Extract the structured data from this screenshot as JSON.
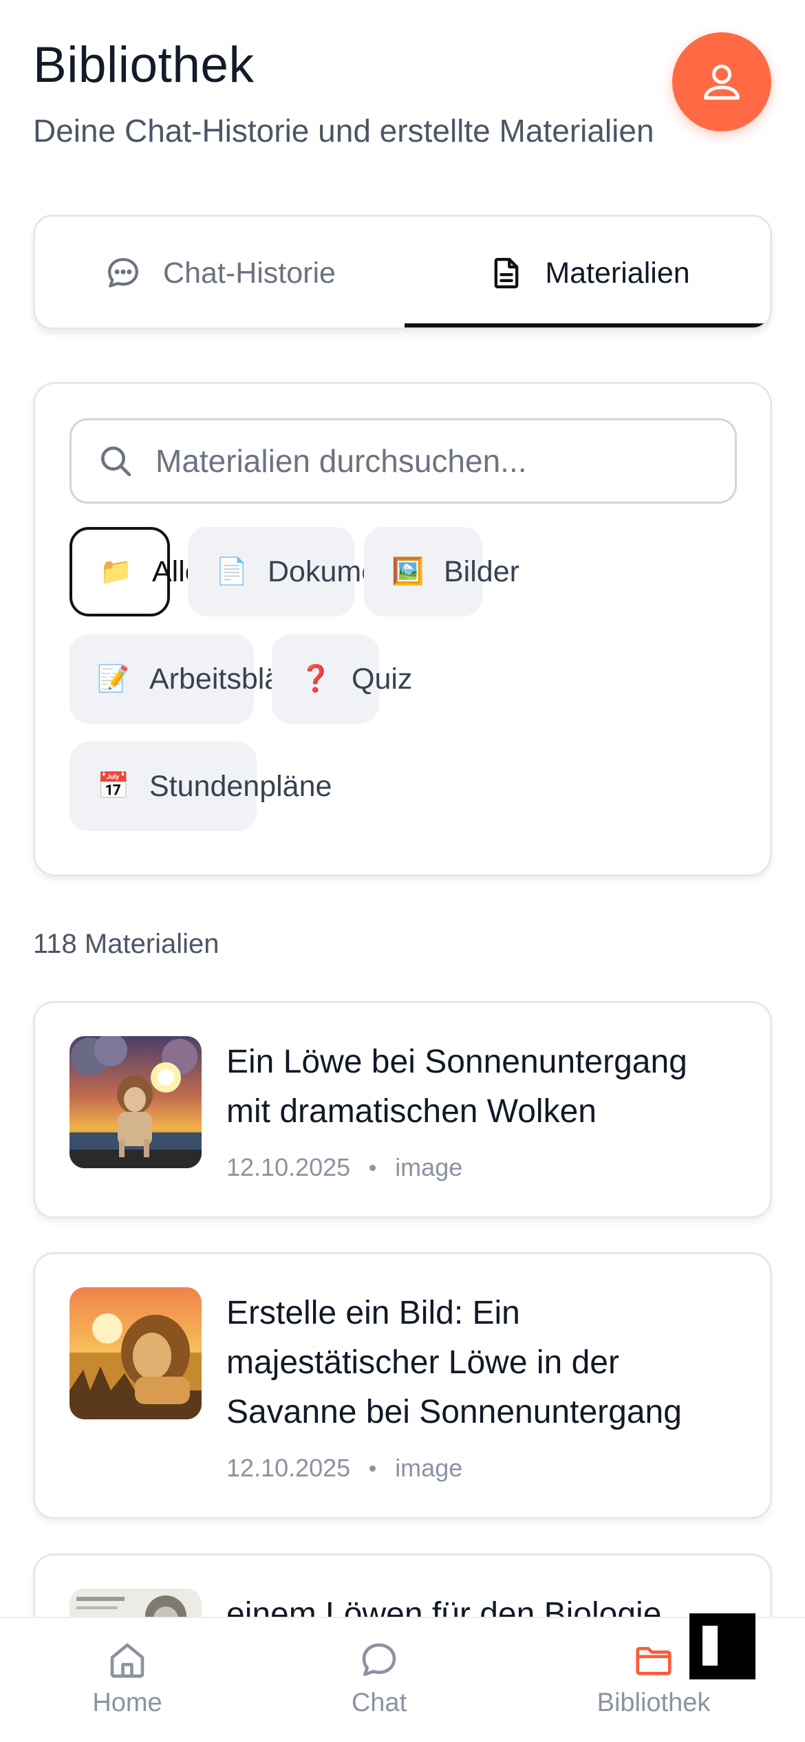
{
  "header": {
    "title": "Bibliothek",
    "subtitle": "Deine Chat-Historie und erstellte Materialien"
  },
  "profile": {
    "icon": "user-icon",
    "color": "#ff6a45"
  },
  "tabs": [
    {
      "label": "Chat-Historie",
      "icon": "chat-bubble-icon",
      "active": false
    },
    {
      "label": "Materialien",
      "icon": "document-icon",
      "active": true
    }
  ],
  "search": {
    "placeholder": "Materialien durchsuchen..."
  },
  "filters": [
    {
      "label": "Alle",
      "emoji": "📁",
      "active": true
    },
    {
      "label": "Dokumente",
      "emoji": "📄",
      "active": false
    },
    {
      "label": "Bilder",
      "emoji": "🖼️",
      "active": false
    },
    {
      "label": "Arbeitsblätter",
      "emoji": "📝",
      "active": false
    },
    {
      "label": "Quiz",
      "emoji": "❓",
      "active": false
    },
    {
      "label": "Stundenpläne",
      "emoji": "📅",
      "active": false
    }
  ],
  "count_label": "118 Materialien",
  "materials": [
    {
      "title": "Ein Löwe bei Sonnenuntergang mit dramatischen Wolken",
      "date": "12.10.2025",
      "type": "image"
    },
    {
      "title": "Erstelle ein Bild: Ein majestätischer Löwe in der Savanne bei Sonnenuntergang",
      "date": "12.10.2025",
      "type": "image"
    },
    {
      "title": "einem Löwen für den Biologie",
      "date": "",
      "type": ""
    }
  ],
  "nav": [
    {
      "label": "Home",
      "icon": "home-icon",
      "active": false
    },
    {
      "label": "Chat",
      "icon": "chat-icon",
      "active": false
    },
    {
      "label": "Bibliothek",
      "icon": "folder-icon",
      "active": true
    }
  ],
  "colors": {
    "accent": "#ff5a36",
    "text": "#131a2a",
    "muted": "#8b93a1"
  }
}
